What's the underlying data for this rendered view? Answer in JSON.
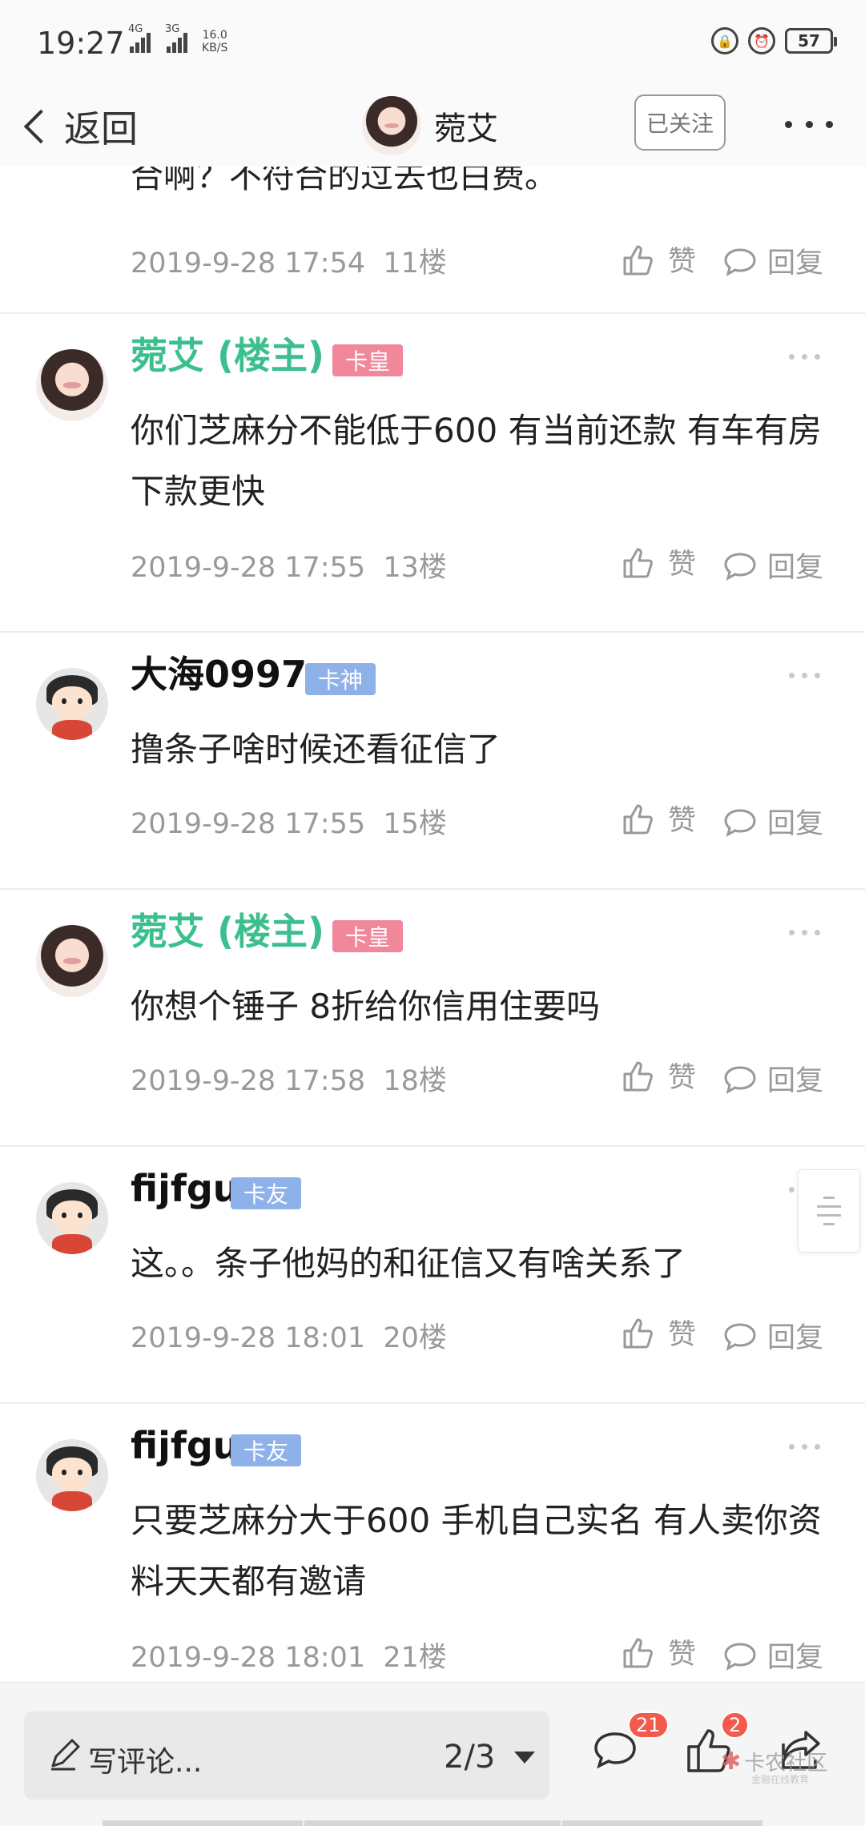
{
  "status_bar": {
    "time": "19:27",
    "net1": "4G",
    "net2": "3G",
    "speed_value": "16.0",
    "speed_unit": "KB/S",
    "battery": "57"
  },
  "nav": {
    "back_label": "返回",
    "title": "菀艾",
    "follow_label": "已关注"
  },
  "partial_comment": {
    "text": "合啊？不符合的过去也白费。",
    "time": "2019-9-28 17:54",
    "floor": "11楼"
  },
  "actions": {
    "like_label": "赞",
    "reply_label": "回复"
  },
  "comments": [
    {
      "name": "菀艾 (楼主)",
      "badge": "卡皇",
      "text": "你们芝麻分不能低于600 有当前还款 有车有房 下款更快",
      "time": "2019-9-28 17:55",
      "floor": "13楼"
    },
    {
      "name": "大海0997",
      "badge": "卡神",
      "text": "撸条子啥时候还看征信了",
      "time": "2019-9-28 17:55",
      "floor": "15楼"
    },
    {
      "name": "菀艾 (楼主)",
      "badge": "卡皇",
      "text": "你想个锤子 8折给你信用住要吗",
      "time": "2019-9-28 17:58",
      "floor": "18楼"
    },
    {
      "name": "fijfgu",
      "badge": "卡友",
      "text": "这。。条子他妈的和征信又有啥关系了",
      "time": "2019-9-28 18:01",
      "floor": "20楼"
    },
    {
      "name": "fijfgu",
      "badge": "卡友",
      "text": "只要芝麻分大于600 手机自己实名 有人卖你资料天天都有邀请",
      "time": "2019-9-28 18:01",
      "floor": "21楼"
    }
  ],
  "bottom_bar": {
    "write_label": "写评论...",
    "page_indicator": "2/3",
    "comment_count": "21",
    "like_count": "2",
    "watermark": "卡农社区",
    "watermark_sub": "金融在线教育"
  },
  "colors": {
    "op_name": "#3cbf8f",
    "badge_red": "#f0879b",
    "badge_blue": "#8fb1ea",
    "count_badge": "#f35a4c"
  },
  "icons": [
    "back-chevron-icon",
    "thumb-up-icon",
    "chat-bubble-icon",
    "pencil-icon",
    "share-icon",
    "more-icon"
  ]
}
